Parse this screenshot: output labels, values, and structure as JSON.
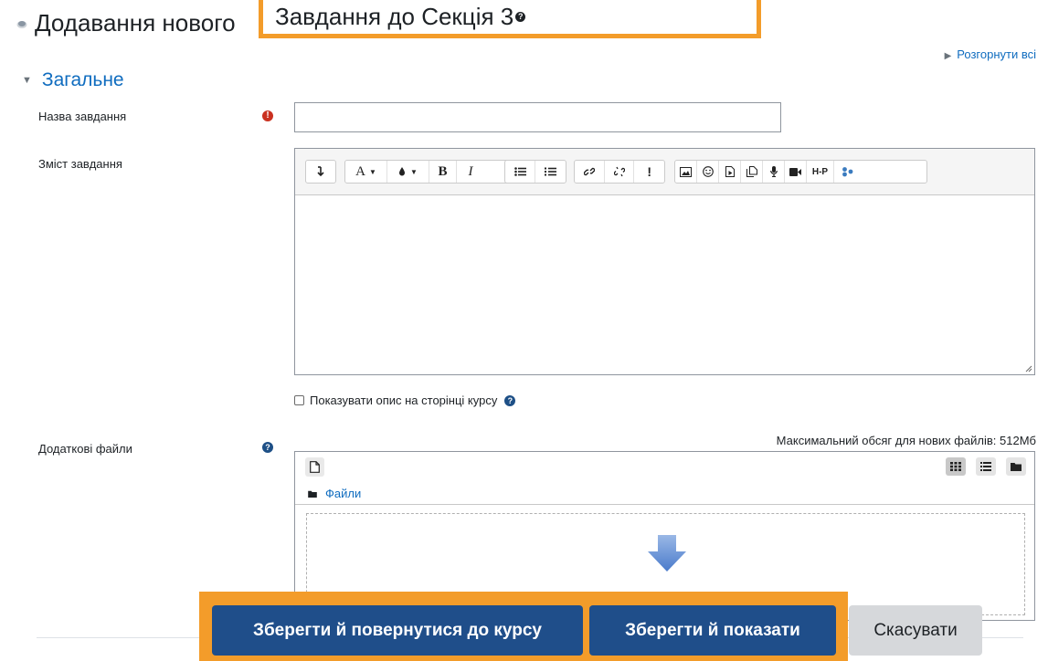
{
  "page": {
    "title_prefix": "Додавання нового",
    "title_highlight": "Завдання до Секція 3",
    "expand_all": "Розгорнути всі"
  },
  "section": {
    "heading": "Загальне"
  },
  "form": {
    "name_label": "Назва завдання",
    "name_value": "",
    "content_label": "Зміст завдання",
    "show_description_label": "Показувати опис на сторінці курсу",
    "show_description_checked": false,
    "files_label": "Додаткові файли",
    "max_size": "Максимальний обсяг для нових файлів: 512Мб",
    "files_folder": "Файли"
  },
  "editor": {
    "toolbar_icons": [
      "toolbar-toggle-icon",
      "font-style-icon",
      "font-color-icon",
      "bold-icon",
      "italic-icon",
      "unordered-list-icon",
      "ordered-list-icon",
      "link-icon",
      "unlink-icon",
      "accessibility-checker-icon",
      "image-icon",
      "emoji-icon",
      "media-icon",
      "manage-files-icon",
      "record-audio-icon",
      "record-video-icon",
      "h5p-icon",
      "screenreader-helper-icon"
    ],
    "bold_glyph": "B",
    "italic_glyph": "I",
    "font_glyph": "A",
    "h5p_glyph": "H-P",
    "warning_glyph": "!"
  },
  "buttons": {
    "save_return": "Зберегти й повернутися до курсу",
    "save_display": "Зберегти й показати",
    "cancel": "Скасувати"
  },
  "colors": {
    "accent": "#f39c2a",
    "primary": "#1f4e8a",
    "link": "#0f6cbf",
    "required": "#ca3120"
  }
}
